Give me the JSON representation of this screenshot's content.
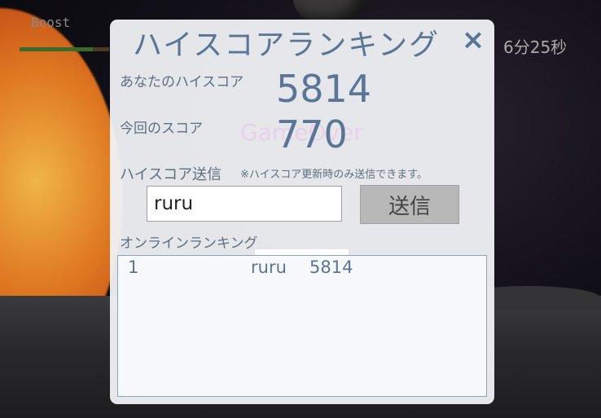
{
  "hud": {
    "boost_label": "Boost",
    "boost_level": 0.82,
    "timer": "6分25秒"
  },
  "dialog": {
    "title": "ハイスコアランキング",
    "close_icon": "×",
    "your_highscore_label": "あなたのハイスコア",
    "your_highscore": "5814",
    "current_score_label": "今回のスコア",
    "current_score": "770",
    "background_text": "GameOver",
    "submit_label": "ハイスコア送信",
    "submit_note": "※ハイスコア更新時のみ送信できます。",
    "name_value": "ruru",
    "send_button": "送信",
    "ranking_label": "オンラインランキング",
    "ranking": [
      {
        "rank": "1",
        "name": "ruru",
        "score": "5814"
      }
    ]
  }
}
